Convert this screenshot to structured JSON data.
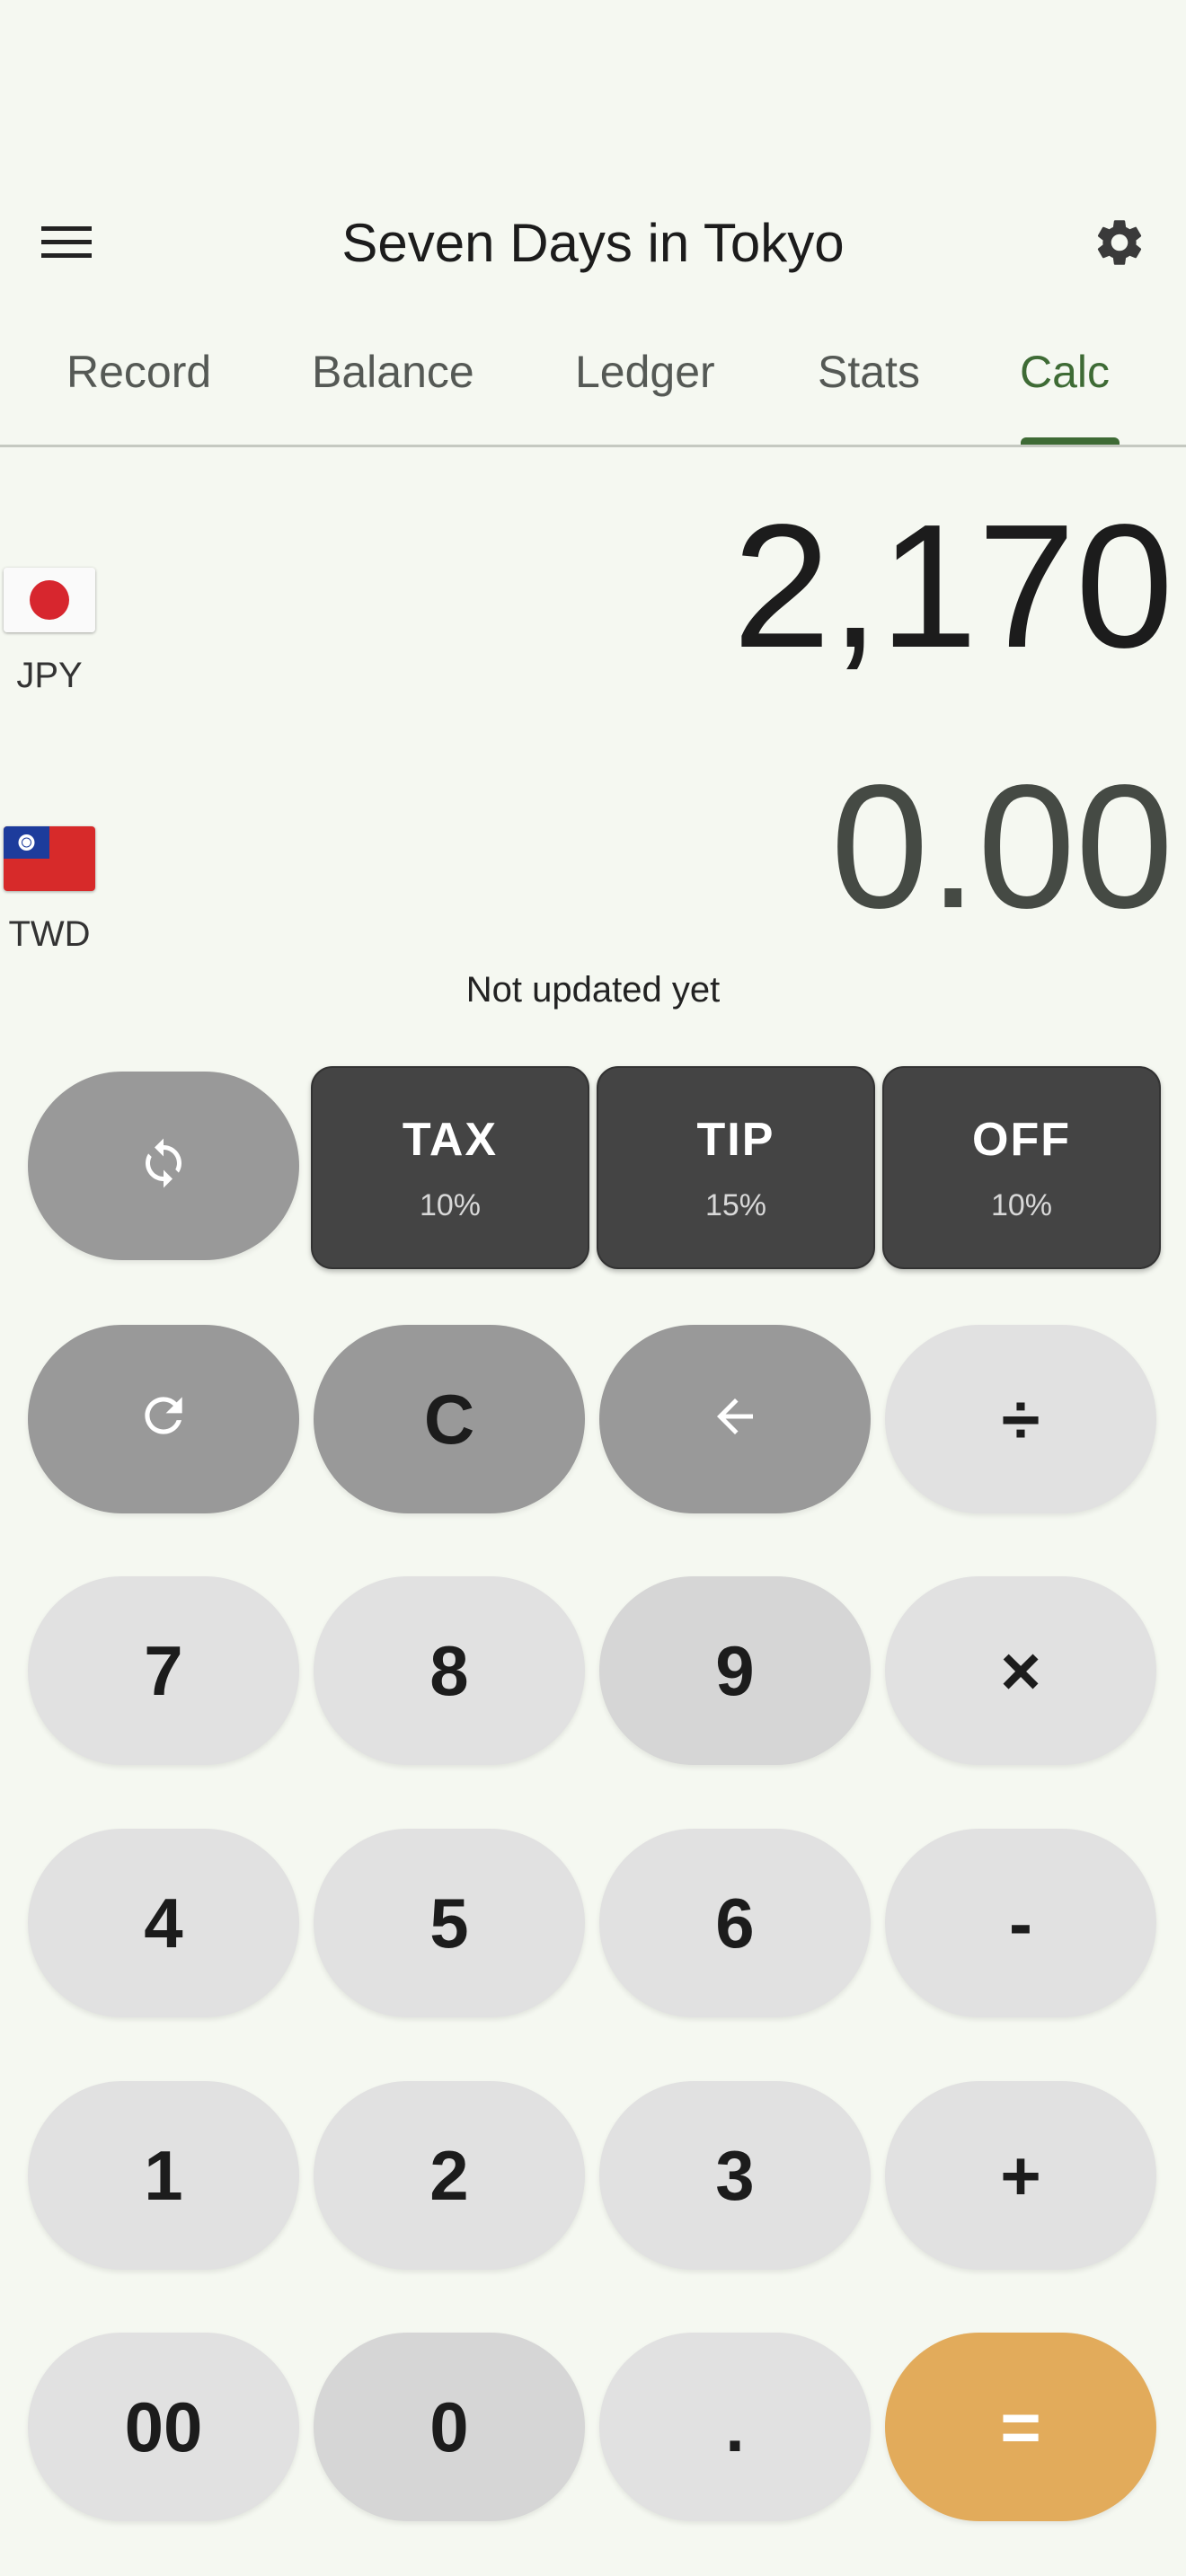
{
  "header": {
    "title": "Seven Days in Tokyo"
  },
  "tabs": [
    {
      "label": "Record"
    },
    {
      "label": "Balance"
    },
    {
      "label": "Ledger"
    },
    {
      "label": "Stats"
    },
    {
      "label": "Calc"
    }
  ],
  "active_tab": "Calc",
  "currencies": [
    {
      "code": "JPY",
      "amount": "2,170"
    },
    {
      "code": "TWD",
      "amount": "0.00"
    }
  ],
  "rate_status": "Not updated yet",
  "presets": [
    {
      "label": "TAX",
      "percent": "10%"
    },
    {
      "label": "TIP",
      "percent": "15%"
    },
    {
      "label": "OFF",
      "percent": "10%"
    }
  ],
  "keys": {
    "clear": "C",
    "divide": "÷",
    "multiply": "×",
    "minus": "-",
    "plus": "+",
    "equals": "=",
    "dot": ".",
    "double_zero": "00",
    "n0": "0",
    "n1": "1",
    "n2": "2",
    "n3": "3",
    "n4": "4",
    "n5": "5",
    "n6": "6",
    "n7": "7",
    "n8": "8",
    "n9": "9"
  },
  "colors": {
    "accent": "#3e6b35",
    "equals": "#e2ab5b",
    "preset_bg": "#444444",
    "background": "#f5f8f1"
  }
}
